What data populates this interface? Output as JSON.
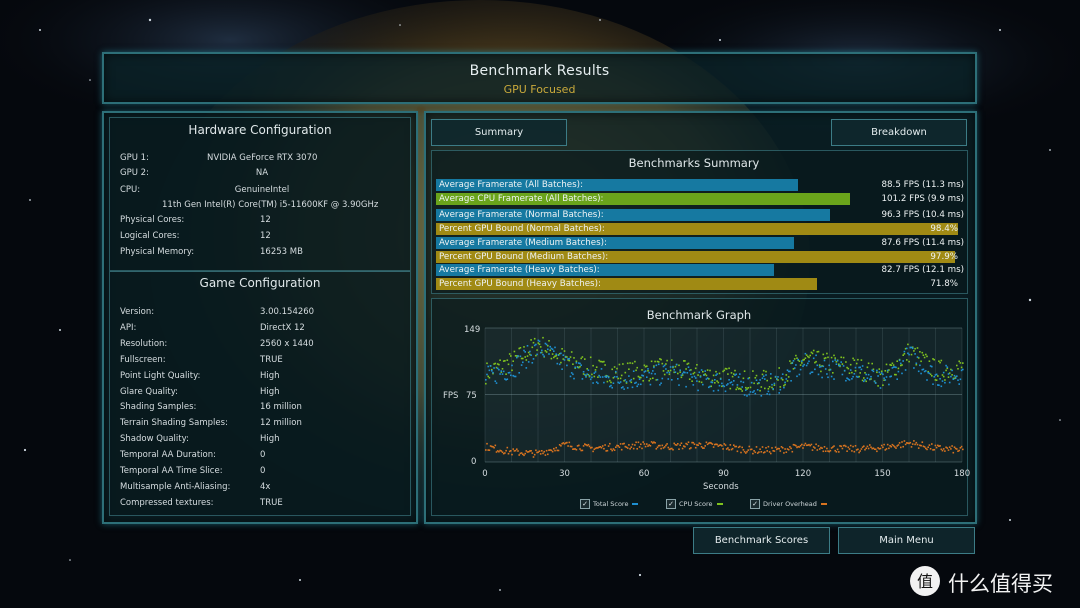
{
  "header": {
    "title": "Benchmark Results",
    "subtitle": "GPU Focused"
  },
  "hardware": {
    "title": "Hardware Configuration",
    "rows": [
      {
        "label": "GPU 1:",
        "value": "NVIDIA GeForce RTX 3070"
      },
      {
        "label": "GPU 2:",
        "value": "NA"
      },
      {
        "label": "CPU:",
        "value": "GenuineIntel"
      },
      {
        "label": "",
        "value": "11th Gen Intel(R) Core(TM) i5-11600KF @ 3.90GHz"
      },
      {
        "label": "Physical Cores:",
        "value": "12"
      },
      {
        "label": "Logical Cores:",
        "value": "12"
      },
      {
        "label": "Physical Memory:",
        "value": "16253  MB"
      }
    ]
  },
  "game": {
    "title": "Game Configuration",
    "rows": [
      {
        "label": "Version:",
        "value": "3.00.154260"
      },
      {
        "label": "API:",
        "value": "DirectX 12"
      },
      {
        "label": "Resolution:",
        "value": "2560 x 1440"
      },
      {
        "label": "Fullscreen:",
        "value": "TRUE"
      },
      {
        "label": "Point Light Quality:",
        "value": "High"
      },
      {
        "label": "Glare Quality:",
        "value": "High"
      },
      {
        "label": "Shading Samples:",
        "value": "16 million"
      },
      {
        "label": "Terrain Shading Samples:",
        "value": "12 million"
      },
      {
        "label": "Shadow Quality:",
        "value": "High"
      },
      {
        "label": "Temporal AA Duration:",
        "value": "0"
      },
      {
        "label": "Temporal AA Time Slice:",
        "value": "0"
      },
      {
        "label": "Multisample Anti-Aliasing:",
        "value": "4x"
      },
      {
        "label": "Compressed textures:",
        "value": "TRUE"
      }
    ]
  },
  "tabs": {
    "summary": "Summary",
    "breakdown": "Breakdown"
  },
  "summary": {
    "title": "Benchmarks Summary",
    "colors": {
      "blue": "#1679a1",
      "green": "#6aa41b",
      "yellow": "#a08a14"
    },
    "rows": [
      {
        "label": "Average Framerate (All Batches):",
        "value": "88.5 FPS (11.3 ms)",
        "fraction": 0.683,
        "color": "blue"
      },
      {
        "label": "Average CPU Framerate (All Batches):",
        "value": "101.2 FPS (9.9 ms)",
        "fraction": 0.781,
        "color": "green"
      },
      {
        "label": "Average Framerate (Normal Batches):",
        "value": "96.3 FPS (10.4 ms)",
        "fraction": 0.743,
        "color": "blue"
      },
      {
        "label": "Percent GPU Bound (Normal Batches):",
        "value": "98.4%",
        "fraction": 0.984,
        "color": "yellow"
      },
      {
        "label": "Average Framerate (Medium Batches):",
        "value": "87.6 FPS (11.4 ms)",
        "fraction": 0.676,
        "color": "blue"
      },
      {
        "label": "Percent GPU Bound (Medium Batches):",
        "value": "97.9%",
        "fraction": 0.979,
        "color": "yellow"
      },
      {
        "label": "Average Framerate (Heavy Batches):",
        "value": "82.7 FPS (12.1 ms)",
        "fraction": 0.638,
        "color": "blue"
      },
      {
        "label": "Percent GPU Bound (Heavy Batches):",
        "value": "71.8%",
        "fraction": 0.718,
        "color": "yellow"
      }
    ]
  },
  "graph": {
    "title": "Benchmark Graph",
    "ylabel": "FPS",
    "xlabel": "Seconds",
    "y_ticks": [
      "149",
      "75",
      "0"
    ],
    "x_ticks": [
      "0",
      "30",
      "60",
      "90",
      "120",
      "150",
      "180"
    ],
    "legend": [
      {
        "label": "Total Score",
        "color": "#1e8fd0"
      },
      {
        "label": "CPU Score",
        "color": "#7fc21e"
      },
      {
        "label": "Driver Overhead",
        "color": "#d8731f"
      }
    ]
  },
  "chart_data": {
    "type": "scatter",
    "title": "Benchmark Graph",
    "xlabel": "Seconds",
    "ylabel": "FPS",
    "xlim": [
      0,
      180
    ],
    "ylim": [
      0,
      149
    ],
    "grid": true,
    "legend_position": "bottom",
    "series": [
      {
        "name": "Total Score",
        "x": [
          0,
          10,
          20,
          30,
          40,
          50,
          60,
          70,
          80,
          90,
          100,
          110,
          120,
          130,
          140,
          150,
          160,
          170,
          180
        ],
        "values": [
          95,
          105,
          128,
          110,
          95,
          92,
          95,
          100,
          92,
          90,
          85,
          88,
          110,
          105,
          102,
          88,
          120,
          95,
          100
        ]
      },
      {
        "name": "CPU Score",
        "x": [
          0,
          10,
          20,
          30,
          40,
          50,
          60,
          70,
          80,
          90,
          100,
          110,
          120,
          130,
          140,
          150,
          160,
          170,
          180
        ],
        "values": [
          100,
          112,
          132,
          115,
          105,
          100,
          102,
          105,
          98,
          95,
          90,
          92,
          115,
          110,
          106,
          95,
          124,
          102,
          106
        ]
      },
      {
        "name": "Driver Overhead",
        "x": [
          0,
          10,
          20,
          30,
          40,
          50,
          60,
          70,
          80,
          90,
          100,
          110,
          120,
          130,
          140,
          150,
          160,
          170,
          180
        ],
        "values": [
          18,
          12,
          10,
          20,
          16,
          18,
          20,
          18,
          20,
          18,
          14,
          14,
          18,
          16,
          15,
          17,
          22,
          16,
          14
        ]
      }
    ]
  },
  "buttons": {
    "benchmark_scores": "Benchmark Scores",
    "main_menu": "Main Menu"
  },
  "watermark": "什么值得买"
}
